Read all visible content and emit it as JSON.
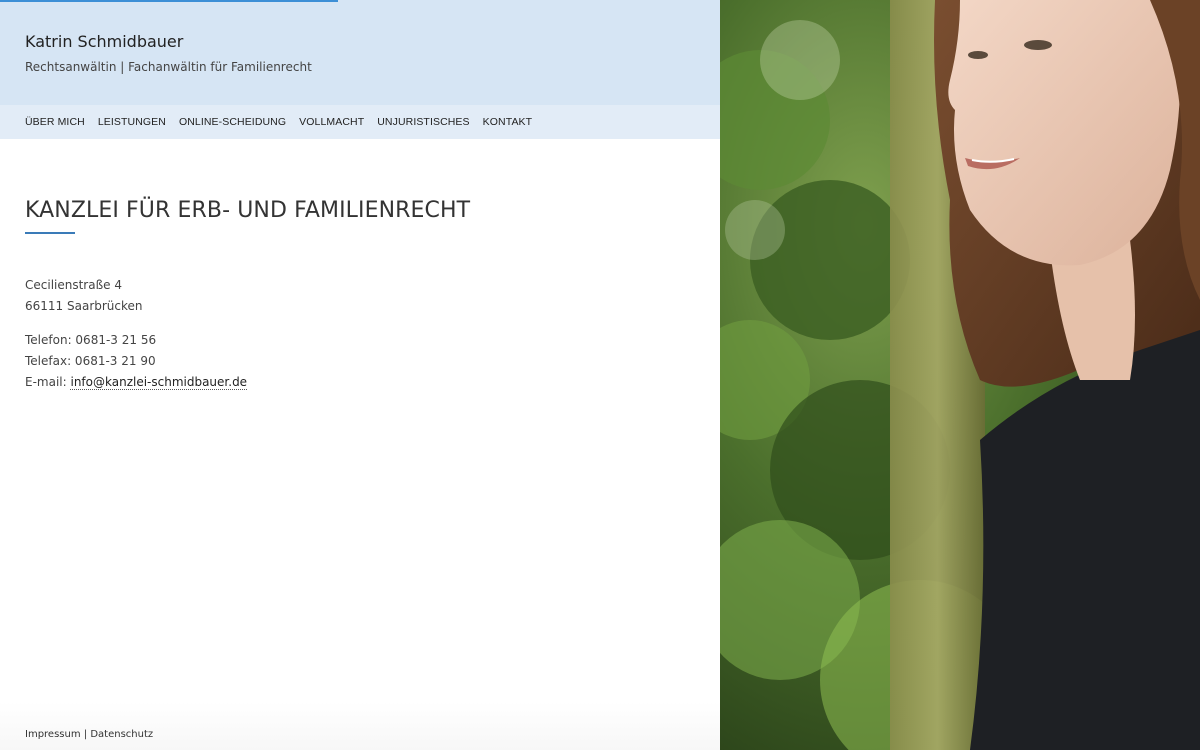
{
  "header": {
    "name": "Katrin Schmidbauer",
    "subtitle": "Rechtsanwältin | Fachanwältin für Familienrecht"
  },
  "nav": {
    "items": [
      "ÜBER MICH",
      "LEISTUNGEN",
      "ONLINE-SCHEIDUNG",
      "VOLLMACHT",
      "UNJURISTISCHES",
      "KONTAKT"
    ]
  },
  "main": {
    "title": "KANZLEI FÜR ERB- UND FAMILIENRECHT",
    "street": "Cecilienstraße 4",
    "city": "66111 Saarbrücken",
    "phone": "Telefon: 0681-3 21 56",
    "fax": "Telefax: 0681-3 21 90",
    "email_label": "E-mail: ",
    "email": "info@kanzlei-schmidbauer.de"
  },
  "footer": {
    "impressum": "Impressum",
    "separator": "|",
    "datenschutz": "Datenschutz"
  },
  "colors": {
    "header_bg": "#d6e5f4",
    "nav_bg": "#e2ecf7",
    "accent": "#3a7bb8",
    "progress": "#3d8fd6"
  }
}
